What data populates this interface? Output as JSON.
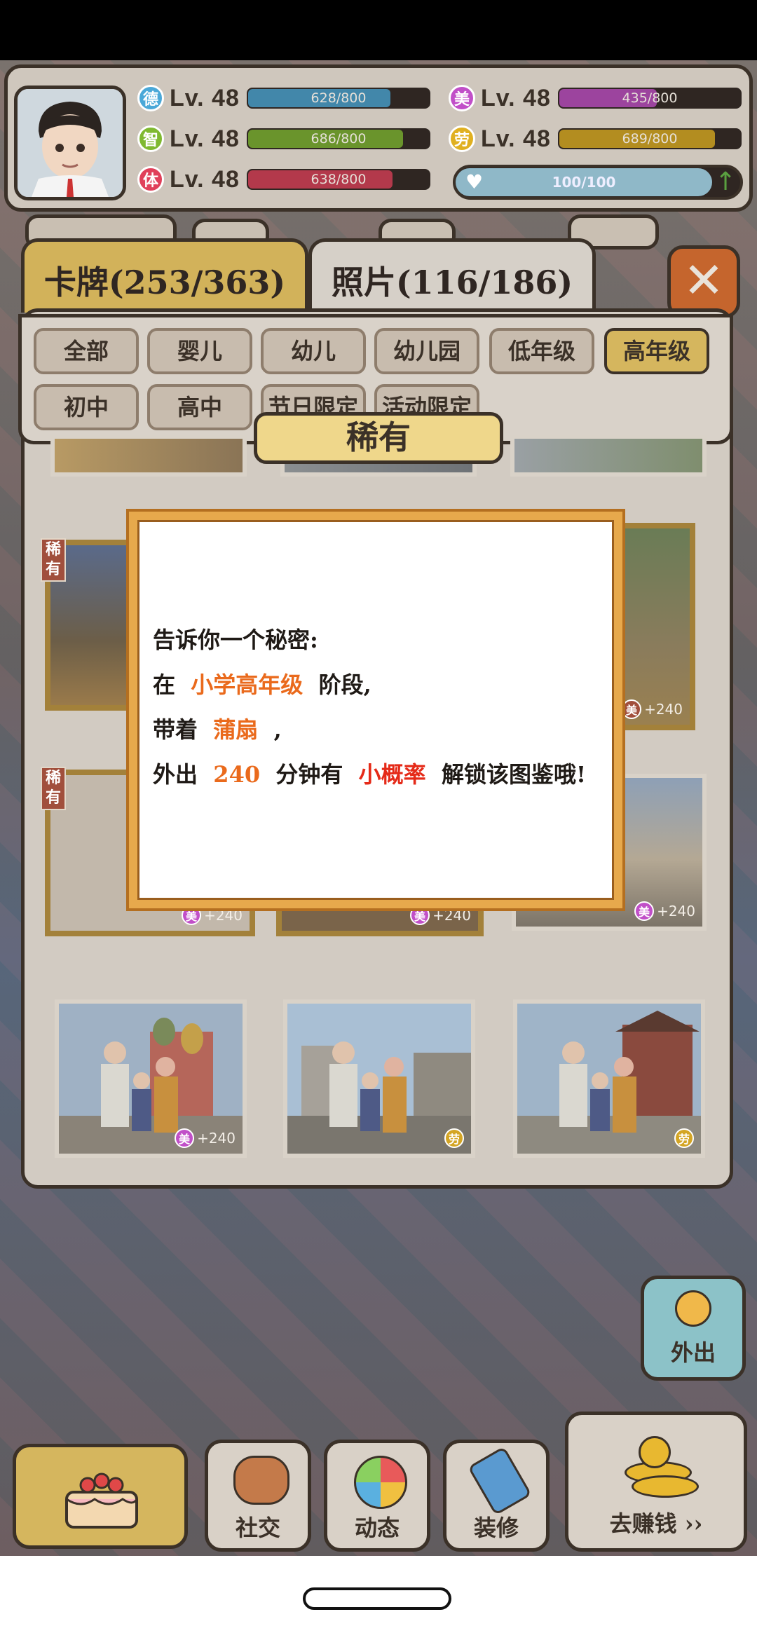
{
  "player": {
    "stats_left": [
      {
        "icon": "德",
        "level": "Lv. 48",
        "progress": "628/800",
        "ratio": 0.785,
        "color": "#4aa8d8"
      },
      {
        "icon": "智",
        "level": "Lv. 48",
        "progress": "686/800",
        "ratio": 0.8575,
        "color": "#7fb930"
      },
      {
        "icon": "体",
        "level": "Lv. 48",
        "progress": "638/800",
        "ratio": 0.7975,
        "color": "#e0405a"
      }
    ],
    "stats_right": [
      {
        "icon": "美",
        "level": "Lv. 48",
        "progress": "435/800",
        "ratio": 0.54,
        "color": "#c14fc8"
      },
      {
        "icon": "劳",
        "level": "Lv. 48",
        "progress": "689/800",
        "ratio": 0.86,
        "color": "#e0b020"
      }
    ],
    "energy": "100/100",
    "energy_ratio": 1.0
  },
  "tabs": {
    "cards": "卡牌(253/363)",
    "photos": "照片(116/186)"
  },
  "filters": [
    {
      "label": "全部",
      "active": false
    },
    {
      "label": "婴儿",
      "active": false
    },
    {
      "label": "幼儿",
      "active": false
    },
    {
      "label": "幼儿园",
      "active": false
    },
    {
      "label": "低年级",
      "active": false
    },
    {
      "label": "高年级",
      "active": true
    },
    {
      "label": "初中",
      "active": false
    },
    {
      "label": "高中",
      "active": false
    },
    {
      "label": "节日限定",
      "active": false
    },
    {
      "label": "活动限定",
      "active": false
    }
  ],
  "section_banner": "稀有",
  "rare_tag": "稀有",
  "card_bonus": "+240",
  "card_bonus_icons": [
    "美",
    "美",
    "美",
    "美",
    "劳",
    "劳"
  ],
  "modal": {
    "line1": "告诉你一个秘密:",
    "line2_a": "在",
    "line2_b": "小学高年级",
    "line2_c": "阶段,",
    "line3_a": "带着",
    "line3_b": "蒲扇",
    "line3_c": ",",
    "line4_a": "外出",
    "line4_b": "240",
    "line4_c": "分钟有",
    "line4_d": "小概率",
    "line4_e": "解锁该图鉴哦!"
  },
  "bottom": {
    "outing": "外出",
    "social": "社交",
    "dynamics": "动态",
    "decorate": "装修",
    "earn": "去赚钱 ››"
  },
  "colors": {
    "accent": "#ea6a1c",
    "alert": "#e52a18",
    "modal_border": "#e7a94c"
  }
}
